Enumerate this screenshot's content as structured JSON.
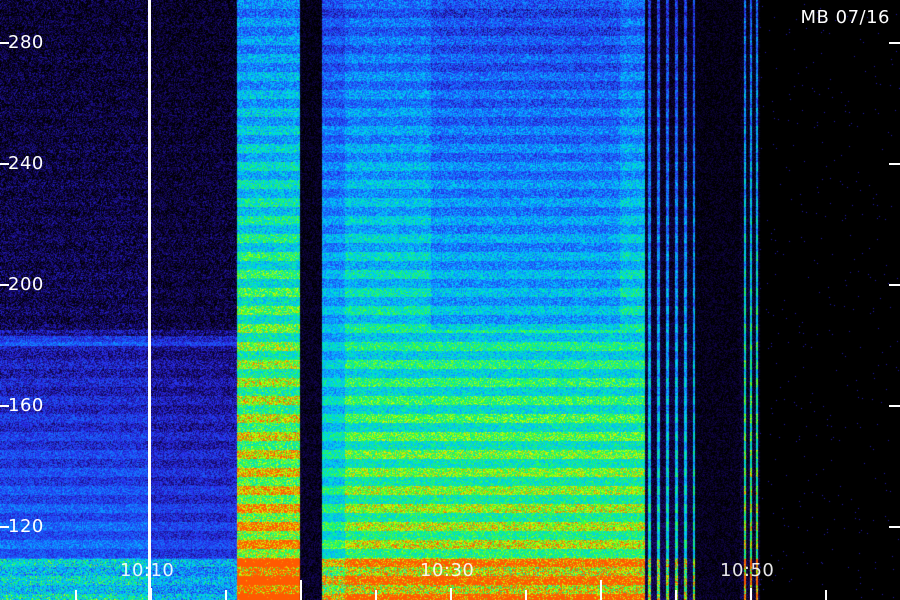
{
  "image": {
    "station_date": "MB 07/16",
    "y_axis": {
      "labels": [
        {
          "text": "280",
          "value": 280
        },
        {
          "text": "240",
          "value": 240
        },
        {
          "text": "200",
          "value": 200
        },
        {
          "text": "160",
          "value": 160
        },
        {
          "text": "120",
          "value": 120
        }
      ]
    },
    "x_axis": {
      "labels": [
        {
          "text": "10:10"
        },
        {
          "text": "10:30"
        },
        {
          "text": "10:50"
        }
      ]
    },
    "colors": {
      "background": "#000000",
      "label": "#ffffff",
      "palette": [
        "#000000",
        "#1a0a7a",
        "#2b3cff",
        "#00a8ff",
        "#00e0c0",
        "#40ff40",
        "#e0ff00",
        "#ff6000"
      ]
    }
  }
}
